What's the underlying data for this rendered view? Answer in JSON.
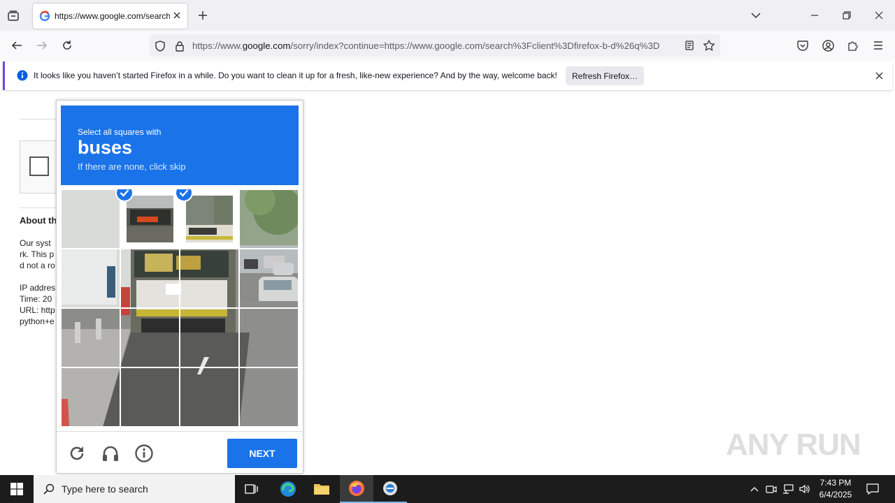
{
  "browser": {
    "tab_title": "https://www.google.com/search",
    "url_prefix": "https://www.",
    "url_domain": "google.com",
    "url_rest": "/sorry/index?continue=https://www.google.com/search%3Fclient%3Dfirefox-b-d%26q%3D",
    "notification_message": "It looks like you haven’t started Firefox in a while. Do you want to clean it up for a fresh, like-new experience? And by the way, welcome back!",
    "notification_button": "Refresh Firefox…"
  },
  "page": {
    "about_heading": "About th",
    "lines": [
      "Our syst",
      "rk. This p",
      "d not a ro",
      "IP addres",
      "Time: 20",
      "URL: http",
      "python+e"
    ]
  },
  "captcha": {
    "instruction": "Select all squares with",
    "target": "buses",
    "hint": "If there are none, click skip",
    "next_label": "NEXT",
    "selected_cells": [
      1,
      2
    ]
  },
  "watermark": "ANY RUN",
  "taskbar": {
    "search_placeholder": "Type here to search",
    "time": "7:43 PM",
    "date": "6/4/2025"
  }
}
